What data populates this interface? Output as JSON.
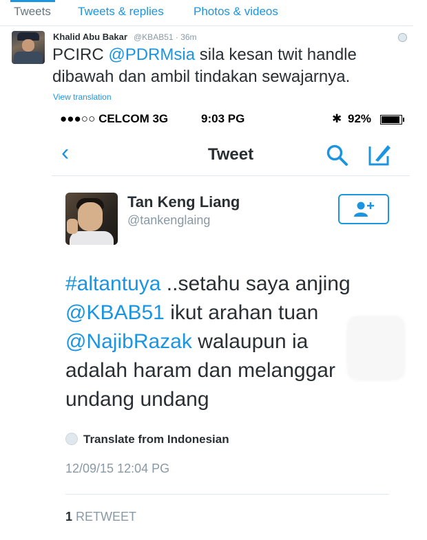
{
  "profile_tabs": [
    {
      "label": "Tweets",
      "active": true
    },
    {
      "label": "Tweets & replies",
      "active": false
    },
    {
      "label": "Photos & videos",
      "active": false
    }
  ],
  "tweet": {
    "author_name": "Khalid Abu Bakar",
    "author_handle": "@KBAB51 · 36m",
    "text_prefix": "PCIRC ",
    "mention": "@PDRMsia",
    "text_suffix": " sila kesan twit handle dibawah dan ambil tindakan sewajarnya.",
    "view_translation": "View translation",
    "icons": {
      "avatar": "avatar-photo",
      "globe": "globe-icon"
    }
  },
  "screenshot": {
    "status_bar": {
      "carrier": "●●●○○ CELCOM  3G",
      "time": "9:03 PG",
      "bluetooth": "✱",
      "battery_pct": "92%",
      "battery_level": 0.92
    },
    "nav": {
      "back": "‹",
      "title": "Tweet"
    },
    "user": {
      "name": "Tan Keng Liang",
      "handle": "@tankenglaing"
    },
    "body": {
      "hashtag": "#altantuya",
      "t1": " ..setahu saya anjing ",
      "mention1": "@KBAB51",
      "t2": " ikut arahan tuan ",
      "mention2": "@NajibRazak",
      "t3": " walaupun ia adalah haram dan melanggar undang undang"
    },
    "translate_label": "Translate from Indonesian",
    "timestamp": "12/09/15 12:04 PG",
    "retweet_count": "1",
    "retweet_label": "RETWEET",
    "accent_color": "#1b95e0"
  }
}
